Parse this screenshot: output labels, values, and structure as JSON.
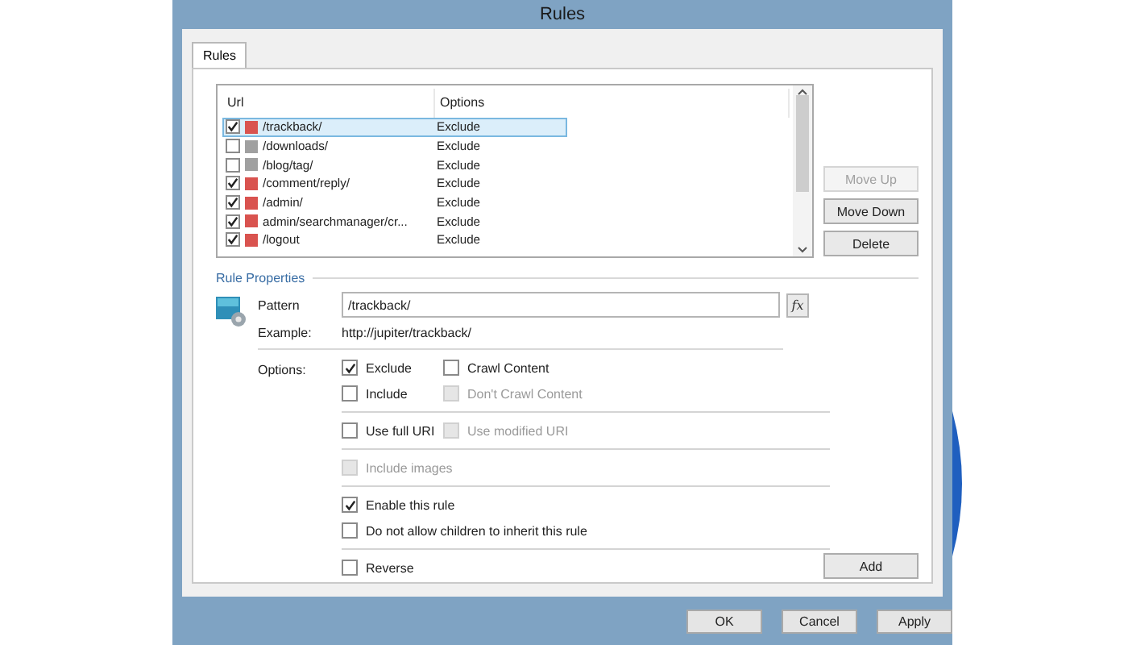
{
  "window": {
    "title": "Rules"
  },
  "tabs": [
    {
      "label": "Rules",
      "selected": true
    }
  ],
  "rule_list": {
    "columns": [
      "Url",
      "Options"
    ],
    "rows": [
      {
        "url": "/trackback/",
        "options": "Exclude",
        "checked": true,
        "color": "#d9534f",
        "selected": true
      },
      {
        "url": "/downloads/",
        "options": "Exclude",
        "checked": false,
        "color": "#a0a0a0",
        "selected": false
      },
      {
        "url": "/blog/tag/",
        "options": "Exclude",
        "checked": false,
        "color": "#a0a0a0",
        "selected": false
      },
      {
        "url": "/comment/reply/",
        "options": "Exclude",
        "checked": true,
        "color": "#d9534f",
        "selected": false
      },
      {
        "url": "/admin/",
        "options": "Exclude",
        "checked": true,
        "color": "#d9534f",
        "selected": false
      },
      {
        "url": "admin/searchmanager/cr...",
        "options": "Exclude",
        "checked": true,
        "color": "#d9534f",
        "selected": false
      },
      {
        "url": "/logout",
        "options": "Exclude",
        "checked": true,
        "color": "#d9534f",
        "selected": false
      }
    ]
  },
  "list_buttons": [
    {
      "label": "Move Up",
      "disabled": true
    },
    {
      "label": "Move Down",
      "disabled": false
    },
    {
      "label": "Delete",
      "disabled": false
    }
  ],
  "rule_properties": {
    "title": "Rule Properties",
    "pattern_label": "Pattern",
    "pattern_value": "/trackback/",
    "function_button": "fx",
    "example_label": "Example:",
    "example_value": "http://jupiter/trackback/",
    "options_label": "Options:",
    "groups": [
      {
        "rows": [
          [
            {
              "label": "Exclude",
              "checked": true,
              "disabled": false
            },
            {
              "label": "Crawl Content",
              "checked": false,
              "disabled": false
            }
          ],
          [
            {
              "label": "Include",
              "checked": false,
              "disabled": false
            },
            {
              "label": "Don't Crawl Content",
              "checked": false,
              "disabled": true
            }
          ]
        ]
      },
      {
        "rows": [
          [
            {
              "label": "Use full URI",
              "checked": false,
              "disabled": false
            },
            {
              "label": "Use modified URI",
              "checked": false,
              "disabled": true
            }
          ]
        ]
      },
      {
        "rows": [
          [
            {
              "label": "Include images",
              "checked": false,
              "disabled": true
            }
          ]
        ]
      },
      {
        "rows": [
          [
            {
              "label": "Enable this rule",
              "checked": true,
              "disabled": false
            }
          ],
          [
            {
              "label": "Do not allow children to inherit this rule",
              "checked": false,
              "disabled": false
            }
          ]
        ]
      },
      {
        "rows": [
          [
            {
              "label": "Reverse",
              "checked": false,
              "disabled": false
            }
          ]
        ]
      }
    ]
  },
  "add_button": "Add",
  "dialog_buttons": [
    "OK",
    "Cancel",
    "Apply"
  ]
}
